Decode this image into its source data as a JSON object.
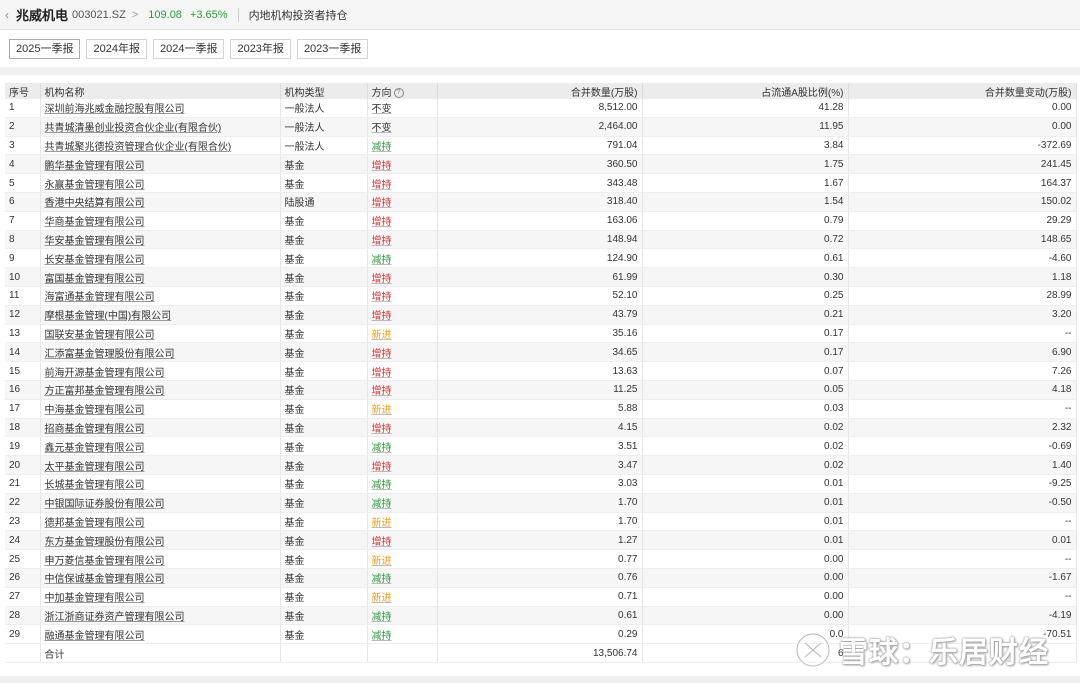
{
  "header": {
    "back_icon": "chevron-left-icon",
    "stock_name": "兆威机电",
    "stock_code": "003021.SZ",
    "chevron": ">",
    "price": "109.08",
    "change": "+3.65%",
    "page_title": "内地机构投资者持仓",
    "price_color": "#2a9b3a"
  },
  "tabs": [
    {
      "label": "2025一季报",
      "active": true
    },
    {
      "label": "2024年报",
      "active": false
    },
    {
      "label": "2024一季报",
      "active": false
    },
    {
      "label": "2023年报",
      "active": false
    },
    {
      "label": "2023一季报",
      "active": false
    }
  ],
  "table": {
    "headers": {
      "idx": "序号",
      "name": "机构名称",
      "type": "机构类型",
      "direction": "方向",
      "shares": "合并数量(万股)",
      "ratio": "占流通A股比例(%)",
      "change": "合并数量变动(万股)"
    },
    "direction_colors": {
      "不变": "#333333",
      "增持": "#e03030",
      "减持": "#2a9b3a",
      "新进": "#f39c12"
    },
    "rows": [
      {
        "idx": "1",
        "name": "深圳前海兆威金融控股有限公司",
        "type": "一般法人",
        "direction": "不变",
        "shares": "8,512.00",
        "ratio": "41.28",
        "change": "0.00"
      },
      {
        "idx": "2",
        "name": "共青城清墨创业投资合伙企业(有限合伙)",
        "type": "一般法人",
        "direction": "不变",
        "shares": "2,464.00",
        "ratio": "11.95",
        "change": "0.00"
      },
      {
        "idx": "3",
        "name": "共青城聚兆德投资管理合伙企业(有限合伙)",
        "type": "一般法人",
        "direction": "减持",
        "shares": "791.04",
        "ratio": "3.84",
        "change": "-372.69"
      },
      {
        "idx": "4",
        "name": "鹏华基金管理有限公司",
        "type": "基金",
        "direction": "增持",
        "shares": "360.50",
        "ratio": "1.75",
        "change": "241.45"
      },
      {
        "idx": "5",
        "name": "永赢基金管理有限公司",
        "type": "基金",
        "direction": "增持",
        "shares": "343.48",
        "ratio": "1.67",
        "change": "164.37"
      },
      {
        "idx": "6",
        "name": "香港中央结算有限公司",
        "type": "陆股通",
        "direction": "增持",
        "shares": "318.40",
        "ratio": "1.54",
        "change": "150.02"
      },
      {
        "idx": "7",
        "name": "华商基金管理有限公司",
        "type": "基金",
        "direction": "增持",
        "shares": "163.06",
        "ratio": "0.79",
        "change": "29.29"
      },
      {
        "idx": "8",
        "name": "华安基金管理有限公司",
        "type": "基金",
        "direction": "增持",
        "shares": "148.94",
        "ratio": "0.72",
        "change": "148.65"
      },
      {
        "idx": "9",
        "name": "长安基金管理有限公司",
        "type": "基金",
        "direction": "减持",
        "shares": "124.90",
        "ratio": "0.61",
        "change": "-4.60"
      },
      {
        "idx": "10",
        "name": "富国基金管理有限公司",
        "type": "基金",
        "direction": "增持",
        "shares": "61.99",
        "ratio": "0.30",
        "change": "1.18"
      },
      {
        "idx": "11",
        "name": "海富通基金管理有限公司",
        "type": "基金",
        "direction": "增持",
        "shares": "52.10",
        "ratio": "0.25",
        "change": "28.99"
      },
      {
        "idx": "12",
        "name": "摩根基金管理(中国)有限公司",
        "type": "基金",
        "direction": "增持",
        "shares": "43.79",
        "ratio": "0.21",
        "change": "3.20"
      },
      {
        "idx": "13",
        "name": "国联安基金管理有限公司",
        "type": "基金",
        "direction": "新进",
        "shares": "35.16",
        "ratio": "0.17",
        "change": "--"
      },
      {
        "idx": "14",
        "name": "汇添富基金管理股份有限公司",
        "type": "基金",
        "direction": "增持",
        "shares": "34.65",
        "ratio": "0.17",
        "change": "6.90"
      },
      {
        "idx": "15",
        "name": "前海开源基金管理有限公司",
        "type": "基金",
        "direction": "增持",
        "shares": "13.63",
        "ratio": "0.07",
        "change": "7.26"
      },
      {
        "idx": "16",
        "name": "方正富邦基金管理有限公司",
        "type": "基金",
        "direction": "增持",
        "shares": "11.25",
        "ratio": "0.05",
        "change": "4.18"
      },
      {
        "idx": "17",
        "name": "中海基金管理有限公司",
        "type": "基金",
        "direction": "新进",
        "shares": "5.88",
        "ratio": "0.03",
        "change": "--"
      },
      {
        "idx": "18",
        "name": "招商基金管理有限公司",
        "type": "基金",
        "direction": "增持",
        "shares": "4.15",
        "ratio": "0.02",
        "change": "2.32"
      },
      {
        "idx": "19",
        "name": "鑫元基金管理有限公司",
        "type": "基金",
        "direction": "减持",
        "shares": "3.51",
        "ratio": "0.02",
        "change": "-0.69"
      },
      {
        "idx": "20",
        "name": "太平基金管理有限公司",
        "type": "基金",
        "direction": "增持",
        "shares": "3.47",
        "ratio": "0.02",
        "change": "1.40"
      },
      {
        "idx": "21",
        "name": "长城基金管理有限公司",
        "type": "基金",
        "direction": "减持",
        "shares": "3.03",
        "ratio": "0.01",
        "change": "-9.25"
      },
      {
        "idx": "22",
        "name": "中银国际证券股份有限公司",
        "type": "基金",
        "direction": "减持",
        "shares": "1.70",
        "ratio": "0.01",
        "change": "-0.50"
      },
      {
        "idx": "23",
        "name": "德邦基金管理有限公司",
        "type": "基金",
        "direction": "新进",
        "shares": "1.70",
        "ratio": "0.01",
        "change": "--"
      },
      {
        "idx": "24",
        "name": "东方基金管理股份有限公司",
        "type": "基金",
        "direction": "增持",
        "shares": "1.27",
        "ratio": "0.01",
        "change": "0.01"
      },
      {
        "idx": "25",
        "name": "申万菱信基金管理有限公司",
        "type": "基金",
        "direction": "新进",
        "shares": "0.77",
        "ratio": "0.00",
        "change": "--"
      },
      {
        "idx": "26",
        "name": "中信保诚基金管理有限公司",
        "type": "基金",
        "direction": "减持",
        "shares": "0.76",
        "ratio": "0.00",
        "change": "-1.67"
      },
      {
        "idx": "27",
        "name": "中加基金管理有限公司",
        "type": "基金",
        "direction": "新进",
        "shares": "0.71",
        "ratio": "0.00",
        "change": "--"
      },
      {
        "idx": "28",
        "name": "浙江浙商证券资产管理有限公司",
        "type": "基金",
        "direction": "减持",
        "shares": "0.61",
        "ratio": "0.00",
        "change": "-4.19"
      },
      {
        "idx": "29",
        "name": "融通基金管理有限公司",
        "type": "基金",
        "direction": "减持",
        "shares": "0.29",
        "ratio": "0.0",
        "change": "-70.51"
      }
    ],
    "total": {
      "label": "合计",
      "shares": "13,506.74",
      "ratio": "6"
    }
  },
  "watermark": {
    "text": "雪球：乐居财经",
    "icon": "snowball-logo-icon"
  }
}
